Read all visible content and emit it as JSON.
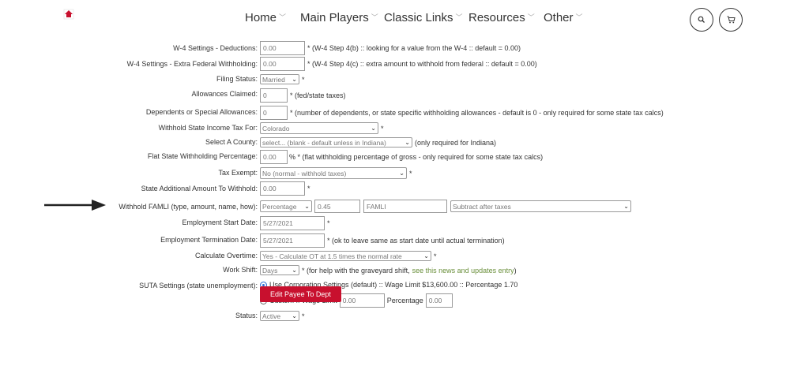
{
  "nav": {
    "items": [
      "Home",
      "Main Players",
      "Classic Links",
      "Resources",
      "Other"
    ]
  },
  "form": {
    "w4_deductions": {
      "label": "W-4 Settings - Deductions:",
      "value": "0.00",
      "note": "* (W-4 Step 4(b) :: looking for a value from the W-4 :: default = 0.00)"
    },
    "w4_extra": {
      "label": "W-4 Settings - Extra Federal Withholding:",
      "value": "0.00",
      "note": "* (W-4 Step 4(c) :: extra amount to withhold from federal :: default = 0.00)"
    },
    "filing_status": {
      "label": "Filing Status:",
      "value": "Married",
      "note": "*"
    },
    "allowances": {
      "label": "Allowances Claimed:",
      "value": "0",
      "note": "* (fed/state taxes)"
    },
    "dependents": {
      "label": "Dependents or Special Allowances:",
      "value": "0",
      "note": "* (number of dependents, or state specific withholding allowances - default is 0 - only required for some state tax calcs)"
    },
    "withhold_state": {
      "label": "Withhold State Income Tax For:",
      "value": "Colorado",
      "note": "*"
    },
    "county": {
      "label": "Select A County:",
      "value": "select... (blank - default unless in Indiana)",
      "note": "(only required for Indiana)"
    },
    "flat_state": {
      "label": "Flat State Withholding Percentage:",
      "value": "0.00",
      "note": "% * (flat withholding percentage of gross - only required for some state tax calcs)"
    },
    "tax_exempt": {
      "label": "Tax Exempt:",
      "value": "No (normal - withhold taxes)",
      "note": "*"
    },
    "state_additional": {
      "label": "State Additional Amount To Withhold:",
      "value": "0.00",
      "note": "*"
    },
    "famli": {
      "label": "Withhold FAMLI (type, amount, name, how):",
      "type": "Percentage",
      "amount": "0.45",
      "name": "FAMLI",
      "how": "Subtract after taxes"
    },
    "start_date": {
      "label": "Employment Start Date:",
      "value": "5/27/2021",
      "note": "*"
    },
    "term_date": {
      "label": "Employment Termination Date:",
      "value": "5/27/2021",
      "note": "* (ok to leave same as start date until actual termination)"
    },
    "overtime": {
      "label": "Calculate Overtime:",
      "value": "Yes - Calculate OT at 1.5 times the normal rate",
      "note": "*"
    },
    "work_shift": {
      "label": "Work Shift:",
      "value": "Days",
      "note": "* (for help with the graveyard shift,",
      "link": "see this news and updates entry",
      "note_end": ")"
    },
    "suta": {
      "label": "SUTA Settings (state unemployment):",
      "option1": "Use Corporation Settings (default) :: Wage Limit $13,600.00 :: Percentage 1.70",
      "option2": "Custom :: Wage Limit",
      "wage_value": "0.00",
      "pct_label": "Percentage",
      "pct_value": "0.00"
    },
    "status": {
      "label": "Status:",
      "value": "Active",
      "note": "*"
    },
    "submit": "Edit Payee To Dept"
  }
}
